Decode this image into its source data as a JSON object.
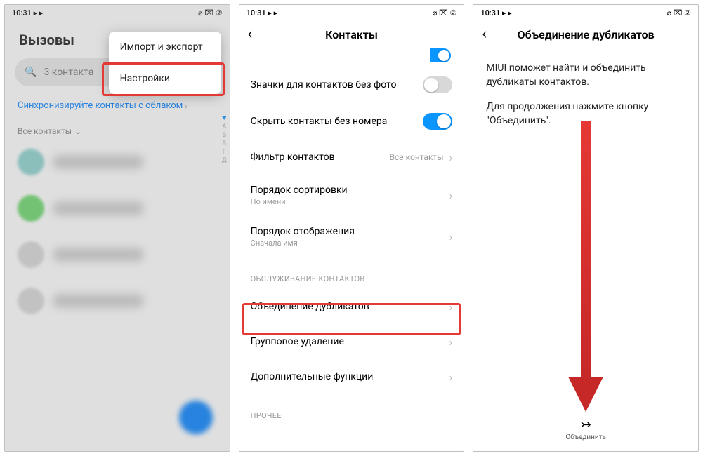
{
  "status": {
    "time": "10:31",
    "icons_right": "⌀ ⌧ ②"
  },
  "phone1": {
    "title": "Вызовы",
    "search_placeholder": "3 контакта",
    "sync_link": "Синхронизируйте контакты с облаком",
    "all_label": "Все контакты",
    "popup": {
      "item1": "Импорт и экспорт",
      "item2": "Настройки"
    },
    "index": [
      "А",
      "Б",
      "В",
      "Г",
      "Д"
    ]
  },
  "phone2": {
    "title": "Контакты",
    "items": {
      "icons_no_photo": "Значки для контактов без фото",
      "hide_no_number": "Скрыть контакты без номера",
      "filter": {
        "label": "Фильтр контактов",
        "value": "Все контакты"
      },
      "sort": {
        "label": "Порядок сортировки",
        "sub": "По имени"
      },
      "display": {
        "label": "Порядок отображения",
        "sub": "Сначала имя"
      }
    },
    "section_maintenance": "ОБСЛУЖИВАНИЕ КОНТАКТОВ",
    "merge_dupes": "Объединение дубликатов",
    "group_delete": "Групповое удаление",
    "extra_funcs": "Дополнительные функции",
    "section_other": "ПРОЧЕЕ"
  },
  "phone3": {
    "title": "Объединение дубликатов",
    "para1": "MIUI поможет найти и объединить дубликаты контактов.",
    "para2": "Для продолжения нажмите кнопку \"Объединить\".",
    "action_label": "Объединить"
  }
}
